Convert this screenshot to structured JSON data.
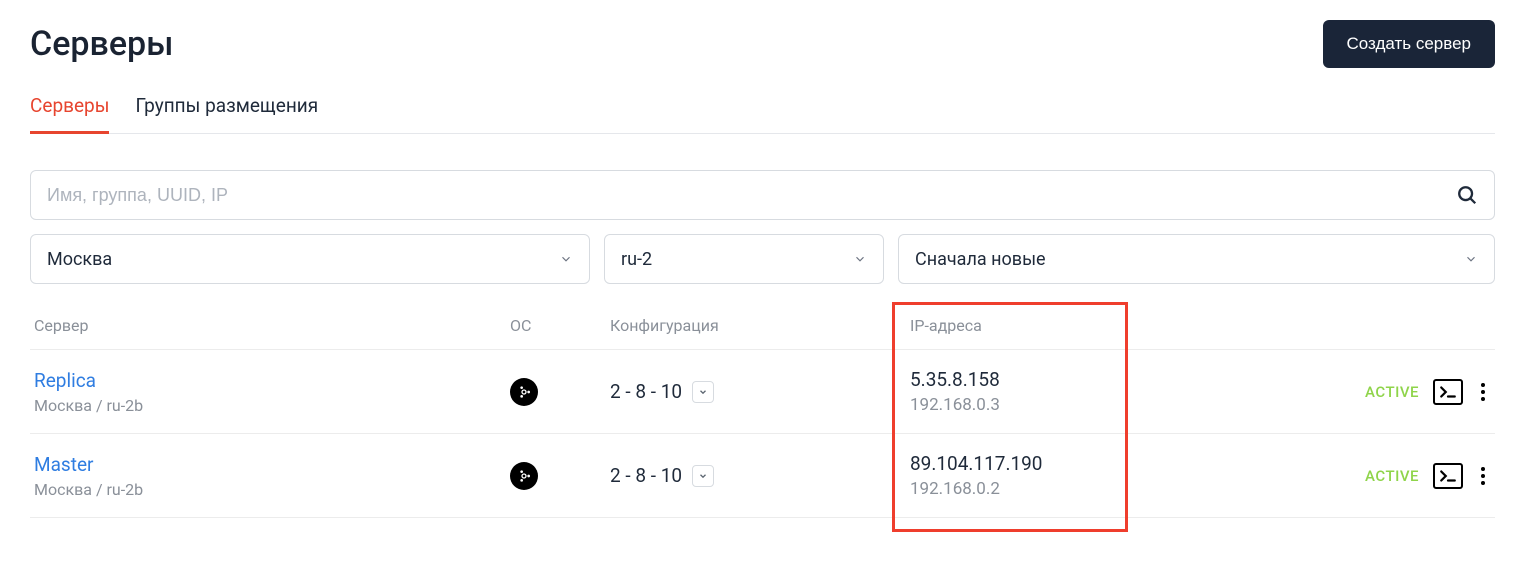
{
  "header": {
    "title": "Серверы",
    "create_button": "Создать сервер"
  },
  "tabs": {
    "servers": "Серверы",
    "placement_groups": "Группы размещения"
  },
  "search": {
    "placeholder": "Имя, группа, UUID, IP"
  },
  "filters": {
    "location": "Москва",
    "region": "ru-2",
    "sort": "Сначала новые"
  },
  "columns": {
    "server": "Сервер",
    "os": "ОС",
    "config": "Конфигурация",
    "ip": "IP-адреса"
  },
  "rows": [
    {
      "name": "Replica",
      "sub": "Москва / ru-2b",
      "config": "2 - 8 - 10",
      "ip_public": "5.35.8.158",
      "ip_private": "192.168.0.3",
      "status": "ACTIVE"
    },
    {
      "name": "Master",
      "sub": "Москва / ru-2b",
      "config": "2 - 8 - 10",
      "ip_public": "89.104.117.190",
      "ip_private": "192.168.0.2",
      "status": "ACTIVE"
    }
  ]
}
